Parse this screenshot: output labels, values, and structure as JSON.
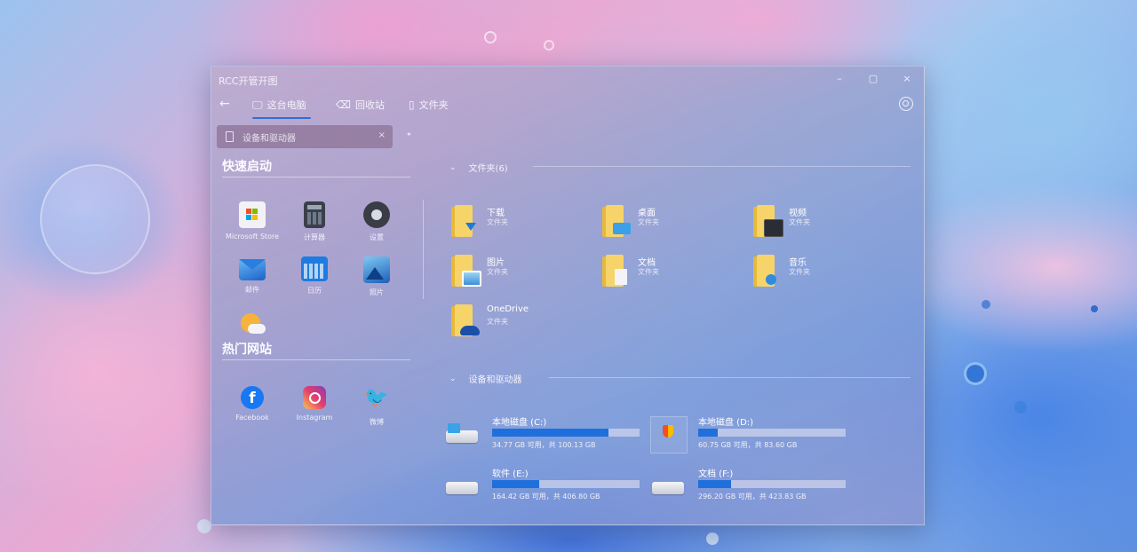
{
  "window": {
    "title": "RCC开管开图",
    "controls": {
      "minimize": "–",
      "maximize": "▢",
      "close": "×"
    }
  },
  "tabs": [
    {
      "label": "这台电脑",
      "icon": "computer-icon",
      "active": true
    },
    {
      "label": "回收站",
      "icon": "recycle-bin-icon"
    },
    {
      "label": "文件夹",
      "icon": "folder-outline-icon"
    }
  ],
  "search": {
    "text": "设备和驱动器",
    "clear": "×",
    "pin": "✦"
  },
  "quick_launch": {
    "title": "快速启动",
    "items": [
      {
        "label": "Microsoft Store",
        "icon": "store-icon"
      },
      {
        "label": "计算器",
        "icon": "calculator-icon"
      },
      {
        "label": "设置",
        "icon": "settings-icon"
      },
      {
        "label": "邮件",
        "icon": "mail-icon"
      },
      {
        "label": "日历",
        "icon": "calendar-icon"
      },
      {
        "label": "照片",
        "icon": "photos-icon"
      },
      {
        "label": "",
        "icon": "weather-icon"
      }
    ]
  },
  "websites": {
    "title": "热门网站",
    "items": [
      {
        "label": "Facebook",
        "icon": "facebook-icon"
      },
      {
        "label": "Instagram",
        "icon": "instagram-icon"
      },
      {
        "label": "微博",
        "icon": "twitter-icon"
      }
    ]
  },
  "folders_group": {
    "title": "文件夹(6)",
    "items": [
      {
        "name": "下载",
        "type": "文件夹",
        "badge": "download-badge"
      },
      {
        "name": "桌面",
        "type": "文件夹",
        "badge": "desktop-badge"
      },
      {
        "name": "视频",
        "type": "文件夹",
        "badge": "video-badge"
      },
      {
        "name": "图片",
        "type": "文件夹",
        "badge": "picture-badge"
      },
      {
        "name": "文档",
        "type": "文件夹",
        "badge": "document-badge"
      },
      {
        "name": "音乐",
        "type": "文件夹",
        "badge": "music-badge"
      },
      {
        "name": "OneDrive",
        "type": "文件夹",
        "badge": "cloud-badge"
      }
    ]
  },
  "drives_group": {
    "title": "设备和驱动器",
    "items": [
      {
        "name": "本地磁盘 (C:)",
        "detail": "34.77 GB 可用，共 100.13 GB",
        "used": 0.79,
        "icon": "system-drive-icon"
      },
      {
        "name": "本地磁盘 (D:)",
        "detail": "60.75 GB 可用，共 83.60 GB",
        "used": 0.13,
        "icon": "shield-drive-icon"
      },
      {
        "name": "软件 (E:)",
        "detail": "164.42 GB 可用，共 406.80 GB",
        "used": 0.32,
        "icon": "drive-icon"
      },
      {
        "name": "文档 (F:)",
        "detail": "296.20 GB 可用，共 423.83 GB",
        "used": 0.22,
        "icon": "drive-icon"
      }
    ]
  },
  "colors": {
    "accent": "#1f70dc",
    "folder": "#f6d46a"
  }
}
